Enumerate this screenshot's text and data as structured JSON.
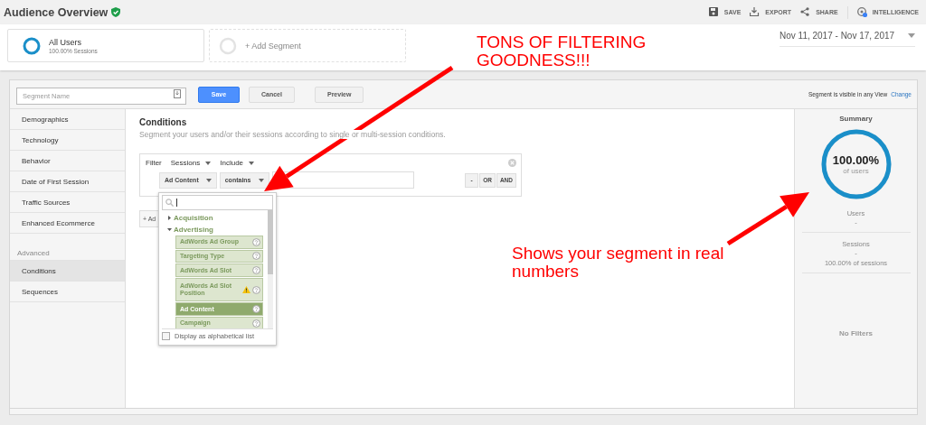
{
  "header": {
    "title": "Audience Overview",
    "verified": true,
    "actions": [
      {
        "label": "SAVE",
        "kind": "save"
      },
      {
        "label": "EXPORT",
        "kind": "export"
      },
      {
        "label": "SHARE",
        "kind": "share"
      },
      {
        "label": "INTELLIGENCE",
        "kind": "intelligence"
      }
    ]
  },
  "segments": [
    {
      "kind": "segment",
      "name": "All Users",
      "detail": "100.00% Sessions"
    },
    {
      "kind": "add",
      "name": "+ Add Segment"
    }
  ],
  "date_range": "Nov 11, 2017 - Nov 17, 2017",
  "editor": {
    "segment_name": {
      "placeholder": "Segment Name"
    },
    "buttons": [
      {
        "label": "Save",
        "kind": "primary"
      },
      {
        "label": "Cancel",
        "kind": "default"
      },
      {
        "label": "Preview",
        "kind": "spaced"
      }
    ],
    "visibility": "Segment is visible in any View",
    "change_link": "Change"
  },
  "nav": {
    "items": [
      {
        "label": "Demographics",
        "selected": false
      },
      {
        "label": "Technology",
        "selected": false
      },
      {
        "label": "Behavior",
        "selected": false
      },
      {
        "label": "Date of First Session",
        "selected": false
      },
      {
        "label": "Traffic Sources",
        "selected": false
      },
      {
        "label": "Enhanced Ecommerce",
        "selected": false
      }
    ],
    "advanced_label": "Advanced",
    "advanced_items": [
      {
        "label": "Conditions",
        "selected": true
      },
      {
        "label": "Sequences",
        "selected": false
      }
    ]
  },
  "conditions": {
    "title": "Conditions",
    "description": "Segment your users and/or their sessions according to single or multi-session conditions.",
    "filter": {
      "label": "Filter",
      "scope": "Sessions",
      "mode": "Include",
      "dimension": "Ad Content",
      "operator": "contains",
      "logic_buttons": [
        "-",
        "OR",
        "AND"
      ]
    },
    "add_button": "+ Ad"
  },
  "dropdown": {
    "tree": [
      {
        "label": "Acquisition",
        "expanded": false
      },
      {
        "label": "Advertising",
        "expanded": true,
        "children": [
          {
            "label": "AdWords Ad Group",
            "selected": false,
            "warning": false
          },
          {
            "label": "Targeting Type",
            "selected": false,
            "warning": false
          },
          {
            "label": "AdWords Ad Slot",
            "selected": false,
            "warning": false
          },
          {
            "label": "AdWords Ad Slot Position",
            "selected": false,
            "warning": true
          },
          {
            "label": "Ad Content",
            "selected": true,
            "warning": false
          },
          {
            "label": "Campaign",
            "selected": false,
            "warning": false
          }
        ]
      }
    ],
    "alphabetical": {
      "label": "Display as alphabetical list",
      "checked": false
    }
  },
  "summary": {
    "title": "Summary",
    "level": 1,
    "percent": "100.00%",
    "caption": "of users",
    "metrics": [
      {
        "label": "Users",
        "value": "-"
      },
      {
        "label": "Sessions",
        "value": "-",
        "detail": "100.00% of sessions"
      }
    ],
    "filters": "No Filters"
  },
  "annotations": [
    {
      "kind": "top",
      "text": "TONS OF FILTERING GOODNESS!!!"
    },
    {
      "kind": "side",
      "text": "Shows your segment in real numbers"
    }
  ]
}
